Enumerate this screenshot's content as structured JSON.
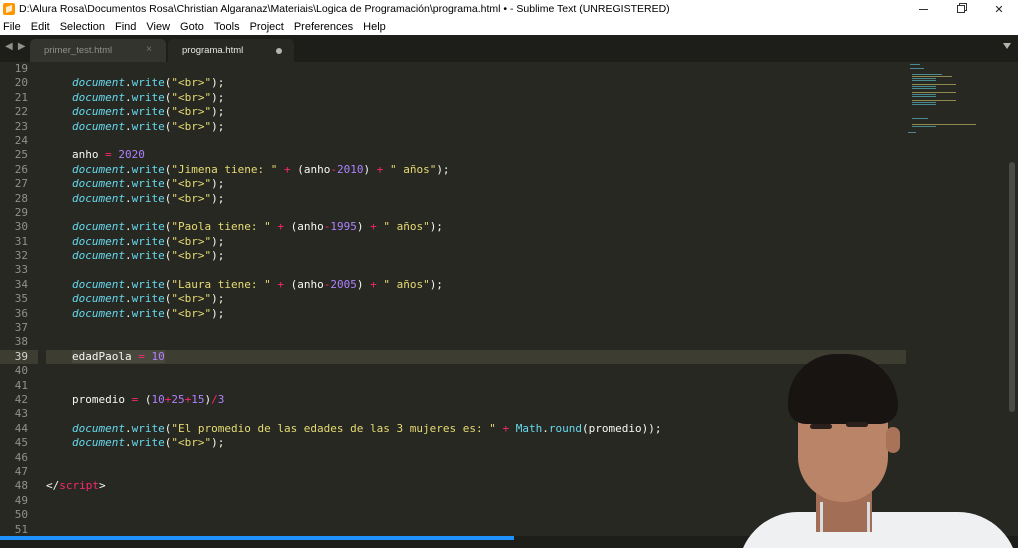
{
  "window": {
    "title": "D:\\Alura Rosa\\Documentos Rosa\\Christian Algaranaz\\Materiais\\Logica de Programación\\programa.html • - Sublime Text (UNREGISTERED)",
    "minimize_glyph": "",
    "maximize_glyph": "",
    "close_glyph": "✕"
  },
  "menu": [
    "File",
    "Edit",
    "Selection",
    "Find",
    "View",
    "Goto",
    "Tools",
    "Project",
    "Preferences",
    "Help"
  ],
  "tabs": {
    "nav_glyph": "◀ ▶",
    "items": [
      {
        "label": "primer_test.html",
        "close_glyph": "×",
        "active": false
      },
      {
        "label": "programa.html",
        "active": true,
        "dirty": true
      }
    ]
  },
  "editor": {
    "current_line": 39,
    "lines": [
      {
        "n": "19"
      },
      {
        "n": "20"
      },
      {
        "n": "21"
      },
      {
        "n": "22"
      },
      {
        "n": "23"
      },
      {
        "n": "24"
      },
      {
        "n": "25"
      },
      {
        "n": "26"
      },
      {
        "n": "27"
      },
      {
        "n": "28"
      },
      {
        "n": "29"
      },
      {
        "n": "30"
      },
      {
        "n": "31"
      },
      {
        "n": "32"
      },
      {
        "n": "33"
      },
      {
        "n": "34"
      },
      {
        "n": "35"
      },
      {
        "n": "36"
      },
      {
        "n": "37"
      },
      {
        "n": "38"
      },
      {
        "n": "39"
      },
      {
        "n": "40"
      },
      {
        "n": "41"
      },
      {
        "n": "42"
      },
      {
        "n": "43"
      },
      {
        "n": "44"
      },
      {
        "n": "45"
      },
      {
        "n": "46"
      },
      {
        "n": "47"
      },
      {
        "n": "48"
      },
      {
        "n": "49"
      },
      {
        "n": "50"
      },
      {
        "n": "51"
      }
    ],
    "code": {
      "kw_document": "document",
      "kw_write": "write",
      "str_br": "\"<br>\"",
      "anho": "anho",
      "eq": "=",
      "plus": "+",
      "minus": "-",
      "div": "/",
      "num_2020": "2020",
      "str_jimena": "\"Jimena tiene: \"",
      "str_paola": "\"Paola tiene: \"",
      "str_laura": "\"Laura tiene: \"",
      "str_anos": "\" años\"",
      "num_2010": "2010",
      "num_1995": "1995",
      "num_2005": "2005",
      "edadPaola": "edadPaola",
      "num_10": "10",
      "promedio": "promedio",
      "num_25": "25",
      "num_15": "15",
      "num_3": "3",
      "str_promedio": "\"El promedio de las edades de las 3 mujeres es: \"",
      "math": "Math",
      "round": "round",
      "close_script_open": "</",
      "close_script_tag": "script",
      "close_script_end": ">"
    }
  },
  "status": {
    "text": "",
    "progress": 0.505
  },
  "colors": {
    "background": "#272822",
    "tabbar": "#1d1e19",
    "keyword": "#66d9ef",
    "string": "#e6db74",
    "operator": "#f92672",
    "number": "#ae81ff",
    "progress": "#1e90ff"
  }
}
